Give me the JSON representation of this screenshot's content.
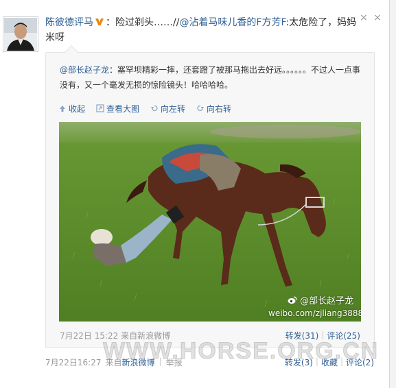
{
  "post": {
    "author": "陈彼德评马",
    "text_segments": [
      {
        "type": "text",
        "value": "：险过剃头……//"
      },
      {
        "type": "mention",
        "value": "@沾着马味儿香的F方芳F"
      },
      {
        "type": "text",
        "value": ":太危险了，妈妈米呀"
      }
    ],
    "close_label": "× ×",
    "meta": {
      "timestamp": "7月22日16:27",
      "source_prefix": "来自",
      "source": "新浪微博",
      "report": "举报"
    },
    "actions": {
      "repost": "转发(3)",
      "favorite": "收藏",
      "comment": "评论(2)"
    }
  },
  "repost": {
    "author": "@部长赵子龙",
    "text": "：塞罕坝精彩一摔，还套蹬了被那马拖出去好远。。。。。。不过人一点事没有，又一个毫发无损的惊险镜头！哈哈哈哈。",
    "toolbar": {
      "collapse": "收起",
      "view_large": "查看大图",
      "rotate_left": "向左转",
      "rotate_right": "向右转"
    },
    "image_watermark": {
      "handle": "@部长赵子龙",
      "url": "weibo.com/zjliang3888"
    },
    "meta": {
      "timestamp": "7月22日 15:22",
      "source_prefix": "来自",
      "source": "新浪微博"
    },
    "actions": {
      "repost": "转发(31)",
      "comment": "评论(25)"
    }
  },
  "site_watermark": "WWW.HORSE.ORG.CN",
  "colors": {
    "link": "#2f6096",
    "muted": "#999999",
    "repost_bg": "#f7f7f7",
    "grass": "#5e8f2e",
    "horse": "#5a2a1a"
  },
  "icons": [
    "close-icon",
    "verified-badge-icon",
    "collapse-icon",
    "zoom-icon",
    "rotate-left-icon",
    "rotate-right-icon",
    "weibo-logo-icon"
  ]
}
